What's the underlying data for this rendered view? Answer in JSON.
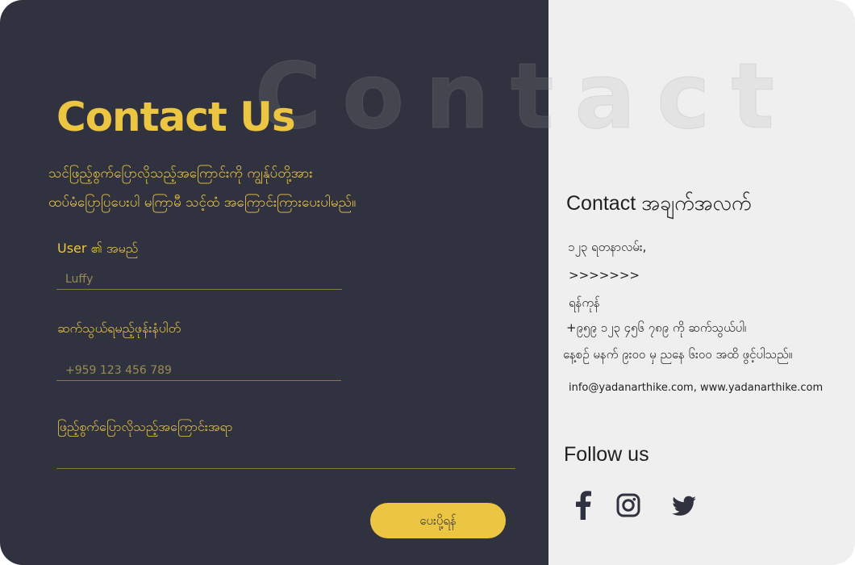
{
  "watermark": "Contact",
  "form": {
    "title": "Contact Us",
    "intro_line1": "သင်ဖြည့်စွက်ပြောလိုသည့်အကြောင်းကို ကျွန်ုပ်တို့အား",
    "intro_line2": "ထပ်မံပြောပြပေးပါ မကြာမီ သင့်ထံ အကြောင်းကြားပေးပါမည်။",
    "name_label": "User ၏ အမည်",
    "name_placeholder": "Luffy",
    "phone_label": "ဆက်သွယ်ရမည့်ဖုန်းနံပါတ်",
    "phone_placeholder": "+959 123 456 789",
    "message_label": "ဖြည့်စွက်ပြောလိုသည့်အကြောင်းအရာ",
    "message_value": "",
    "submit_label": "ပေးပို့ရန်"
  },
  "info": {
    "title": "Contact အချက်အလက်",
    "address_line1": "၁၂၃ ရတနာလမ်း,",
    "address_line2": ">>>>>>>",
    "city": "ရန်ကုန်",
    "phone": "+၉၅၉ ၁၂၃ ၄၅၆ ၇၈၉ ကို ဆက်သွယ်ပါ၊",
    "hours": "နေ့စဉ် မနက် ၉း၀၀ မှ ညနေ ၆း၀၀ အထိ ဖွင့်ပါသည်။",
    "email_web": "info@yadanarthike.com, www.yadanarthike.com"
  },
  "follow": {
    "title": "Follow us",
    "icons": [
      "facebook-icon",
      "instagram-icon",
      "twitter-icon"
    ]
  },
  "colors": {
    "panel_dark": "#30333f",
    "panel_light": "#efefef",
    "accent": "#ecc642"
  }
}
